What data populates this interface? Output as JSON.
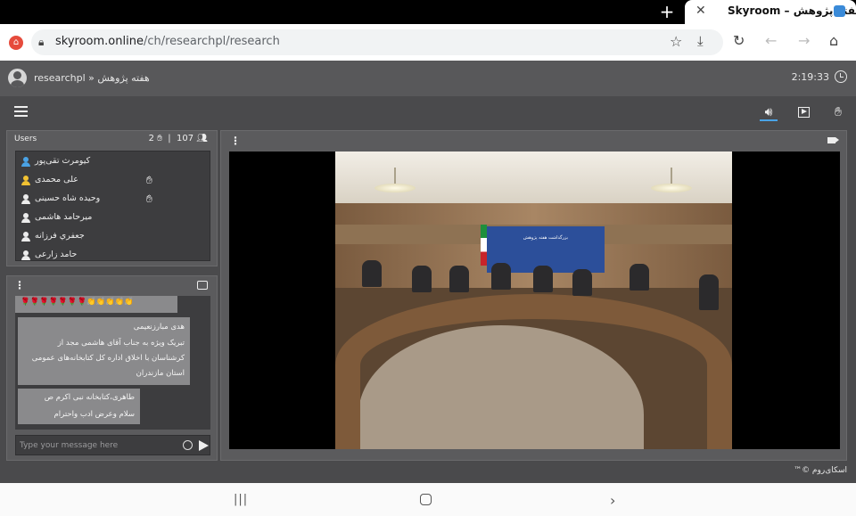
{
  "browser": {
    "tab_title": "Skyroom – هفته پژوهش",
    "new_tab_symbol": "+",
    "url_host": "skyroom.online",
    "url_path": "/ch/researchpl/research"
  },
  "app": {
    "breadcrumb": "researchpl » هفته پژوهش",
    "clock": "2:19:33",
    "users_panel": {
      "title": "Users",
      "raised_hands": "2",
      "online_count": "107",
      "users": [
        {
          "name": "کیومرث تقی‌پور",
          "icon_color": "#4aa3e6",
          "hand": false
        },
        {
          "name": "علی محمدی",
          "icon_color": "#f2c232",
          "hand": true
        },
        {
          "name": "وحیده شاه حسینی",
          "icon_color": "#ececec",
          "hand": true
        },
        {
          "name": "میرحامد هاشمی",
          "icon_color": "#ececec",
          "hand": false
        },
        {
          "name": "جعفري فرزانه",
          "icon_color": "#ececec",
          "hand": false
        },
        {
          "name": "حامد زارعی",
          "icon_color": "#ececec",
          "hand": false
        }
      ]
    },
    "chat_panel": {
      "messages": [
        {
          "emoji_line_red": "🌹🌹🌹🌹🌹🌹🌹",
          "emoji_line_yellow": "👏👏👏👏👏"
        },
        {
          "author": "هدی مبارزنعیمی",
          "lines": [
            "تبریک ویژه به جناب آقای هاشمی مجد از",
            "کرشناسان با اخلاق اداره کل کتابخانه‌های عمومی",
            "استان مازندران"
          ]
        },
        {
          "author": "طاهری،کتابخانه نبی اکرم ص",
          "lines": [
            "سلام وعرض ادب واحترام"
          ]
        }
      ],
      "input_placeholder": "Type your message here"
    },
    "video": {
      "banner_text": "بزرگداشت هفته پژوهش"
    },
    "footer": "اسکای‌روم ©™"
  },
  "colors": {
    "accent": "#4aa3e6",
    "panel_bg": "#5b5b5d",
    "app_bg": "#4a4a4c"
  }
}
